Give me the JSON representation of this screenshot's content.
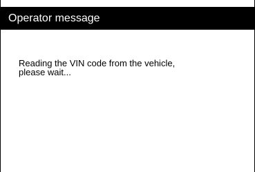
{
  "dialog": {
    "title": "Operator message",
    "message": "Reading the VIN code from the vehicle,\nplease wait..."
  },
  "colors": {
    "title_bar": "#000000",
    "title_text": "#ffffff",
    "body_background": "#ffffff",
    "body_text": "#000000"
  }
}
